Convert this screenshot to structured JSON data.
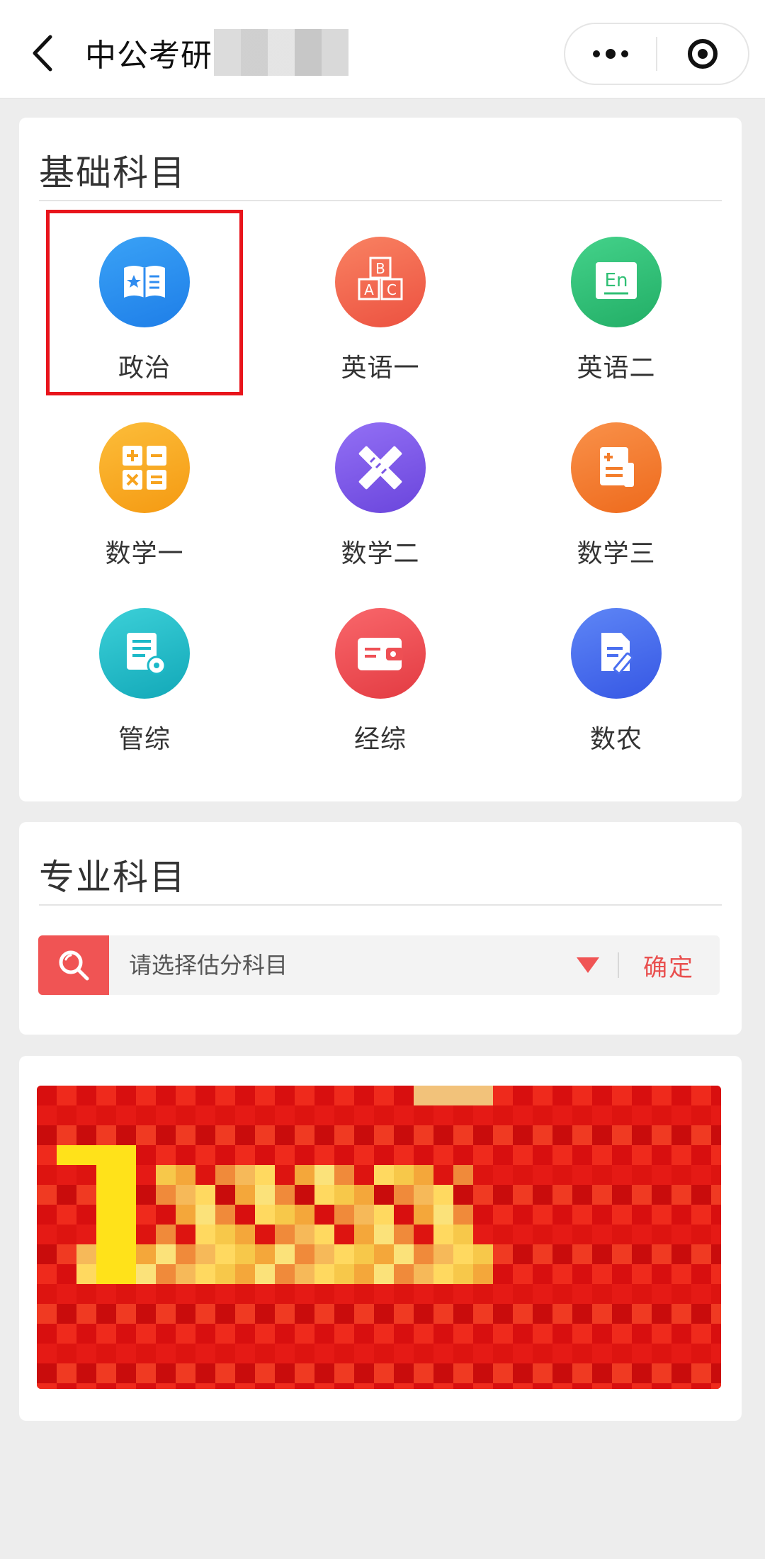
{
  "header": {
    "title": "中公考研",
    "back_icon": "chevron-left-icon",
    "more_icon": "more-dots-icon",
    "close_icon": "record-target-icon"
  },
  "basic": {
    "title": "基础科目",
    "subjects": [
      {
        "label": "政治",
        "icon": "book-icon",
        "color": "#2f8cf0",
        "highlighted": true
      },
      {
        "label": "英语一",
        "icon": "abc-blocks-icon",
        "color": "#f26a4f"
      },
      {
        "label": "英语二",
        "icon": "en-card-icon",
        "color": "#2fbf74"
      },
      {
        "label": "数学一",
        "icon": "calculator-icon",
        "color": "#f7a31e"
      },
      {
        "label": "数学二",
        "icon": "ruler-pencil-icon",
        "color": "#7a55e6"
      },
      {
        "label": "数学三",
        "icon": "document-list-icon",
        "color": "#f37d2b"
      },
      {
        "label": "管综",
        "icon": "doc-gear-icon",
        "color": "#1cb9c8"
      },
      {
        "label": "经综",
        "icon": "wallet-icon",
        "color": "#ee4f54"
      },
      {
        "label": "数农",
        "icon": "edit-doc-icon",
        "color": "#4a6ff0"
      }
    ]
  },
  "major": {
    "title": "专业科目",
    "search": {
      "placeholder": "请选择估分科目",
      "confirm_label": "确定",
      "accent": "#f05454"
    }
  },
  "banner": {
    "icon": "promo-banner-image",
    "color": "#e11212"
  }
}
